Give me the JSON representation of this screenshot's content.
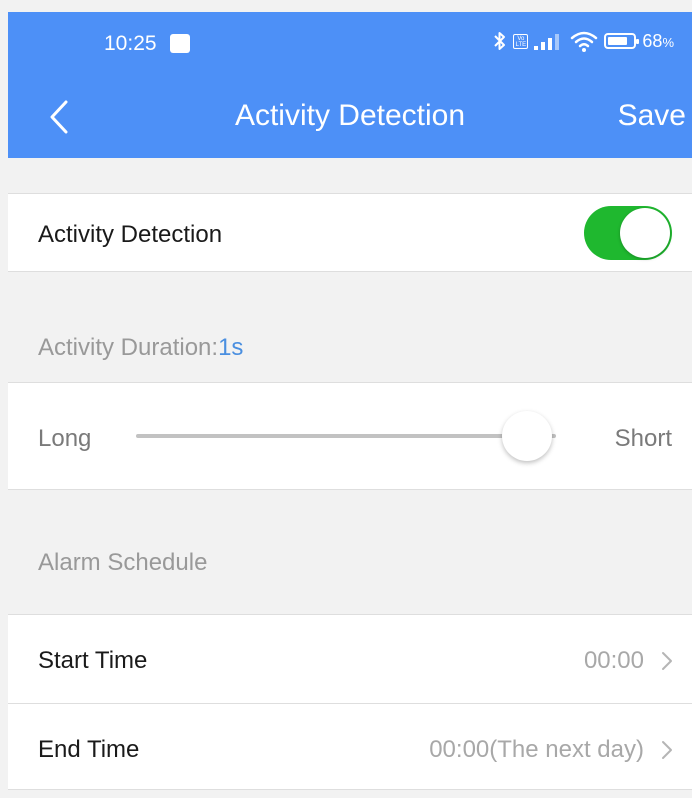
{
  "status_bar": {
    "time": "10:25",
    "volte": "Vo LTE",
    "battery_percent": "68",
    "battery_unit": "%",
    "battery_level": 0.68
  },
  "nav": {
    "title": "Activity Detection",
    "save_label": "Save",
    "color": "#4d90f7"
  },
  "activity_detection": {
    "label": "Activity Detection",
    "enabled": true,
    "toggle_color": "#1fb82f"
  },
  "duration": {
    "label": "Activity Duration:",
    "value": "1s",
    "value_color": "#4a8fe0"
  },
  "slider": {
    "left_label": "Long",
    "right_label": "Short",
    "position": 0.93
  },
  "schedule": {
    "label": "Alarm Schedule",
    "start_label": "Start Time",
    "start_value": "00:00",
    "end_label": "End Time",
    "end_value": "00:00(The next day)"
  },
  "icons": {
    "back": "back-chevron-icon",
    "bluetooth": "bluetooth-icon",
    "signal": "signal-icon",
    "wifi": "wifi-icon",
    "battery": "battery-icon",
    "row_chevron": "chevron-right-icon"
  }
}
